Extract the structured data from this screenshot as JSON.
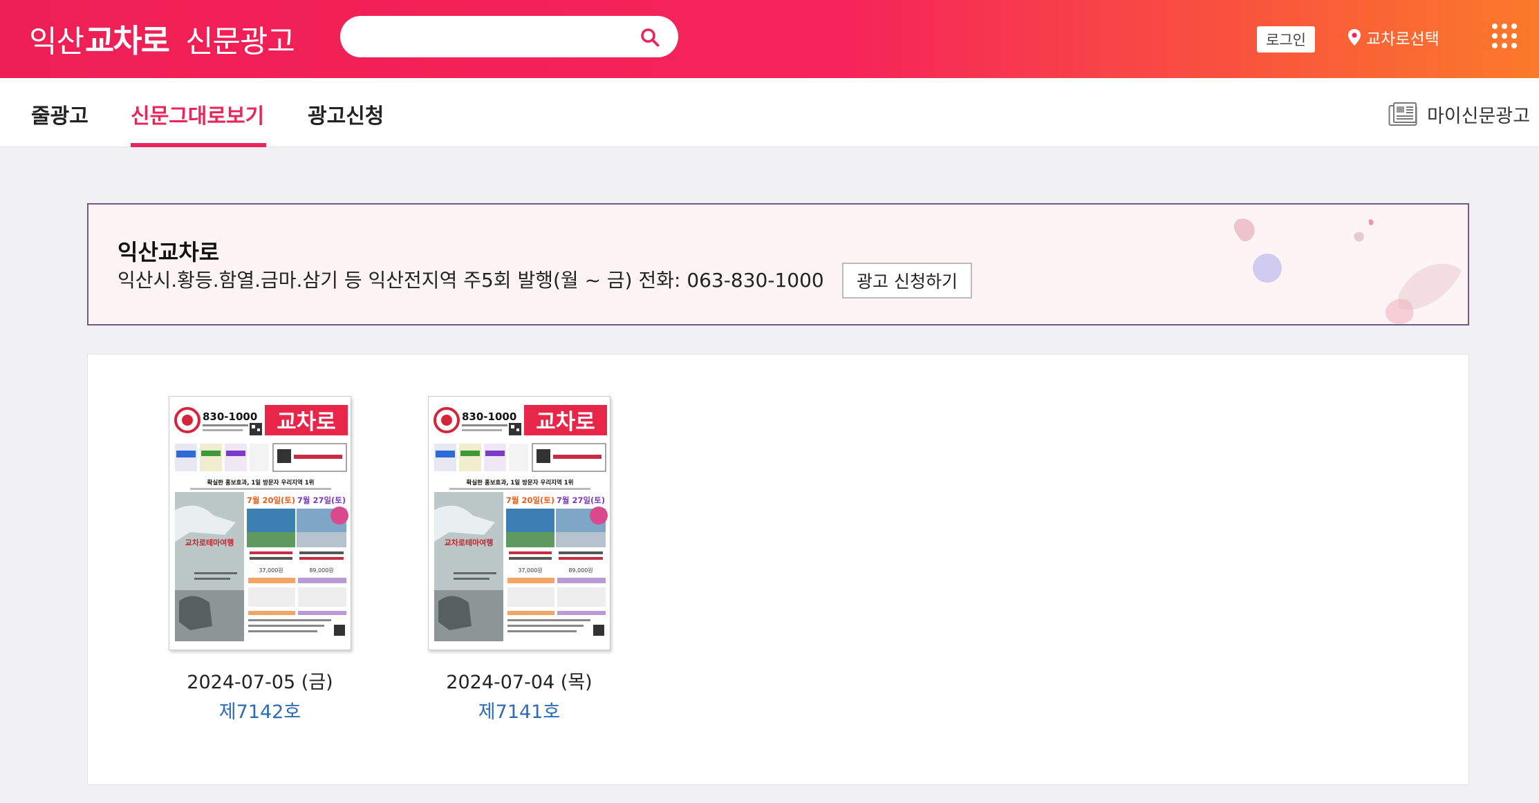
{
  "header": {
    "logo_prefix": "익산",
    "logo_brand": "교차로",
    "logo_suffix": "신문광고",
    "search": {
      "value": "",
      "placeholder": ""
    },
    "login_label": "로그인",
    "region_label": "교차로선택"
  },
  "nav": {
    "tabs": [
      {
        "label": "줄광고",
        "active": false
      },
      {
        "label": "신문그대로보기",
        "active": true
      },
      {
        "label": "광고신청",
        "active": false
      }
    ],
    "my_ads_label": "마이신문광고"
  },
  "info": {
    "title": "익산교차로",
    "description": "익산시.황등.함열.금마.삼기 등 익산전지역 주5회 발행(월 ~ 금) 전화: 063-830-1000",
    "apply_button": "광고 신청하기"
  },
  "papers": [
    {
      "date": "2024-07-05 (금)",
      "issue": "제7142호",
      "cover": {
        "phone": "830-1000",
        "brand": "교차로",
        "headline": "확실한 홍보효과, 1일 방문자 우리지역 1위",
        "event1": "7월 20일(토)",
        "event2": "7월 27일(토)",
        "caption": "교차로테마여행",
        "price1": "37,000원",
        "price2": "89,000원"
      }
    },
    {
      "date": "2024-07-04 (목)",
      "issue": "제7141호",
      "cover": {
        "phone": "830-1000",
        "brand": "교차로",
        "headline": "확실한 홍보효과, 1일 방문자 우리지역 1위",
        "event1": "7월 20일(토)",
        "event2": "7월 27일(토)",
        "caption": "교차로테마여행",
        "price1": "37,000원",
        "price2": "89,000원"
      }
    }
  ],
  "colors": {
    "brand_red": "#ee1f54",
    "brand_orange": "#fb7a2a",
    "active_tab": "#e8265a",
    "issue_link": "#2d6cb5",
    "info_border": "#6f5a86"
  },
  "icons": {
    "search": "search-icon",
    "region": "map-pin-icon",
    "apps": "grid-menu-icon",
    "my_ads": "newspaper-icon"
  }
}
